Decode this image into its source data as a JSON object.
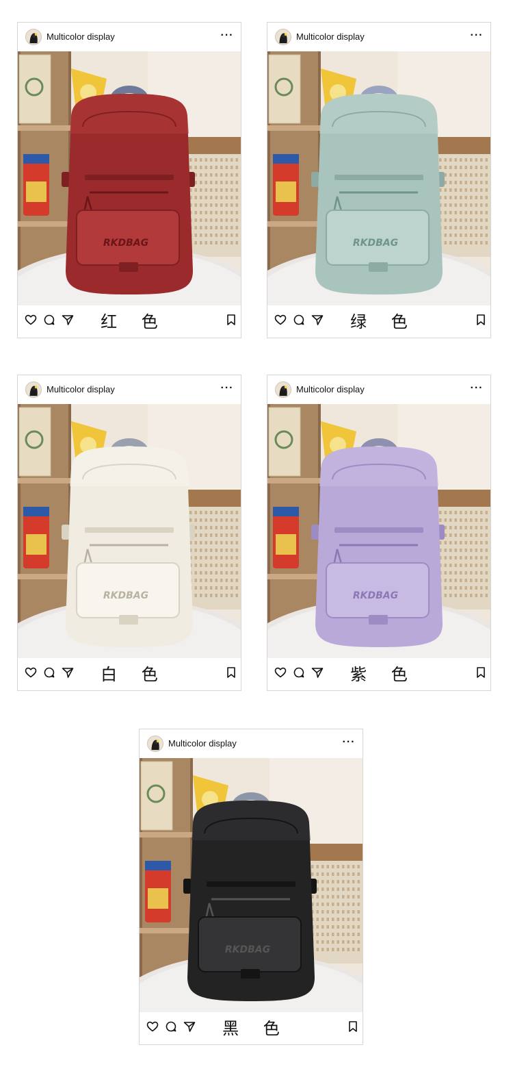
{
  "cards": [
    {
      "username": "Multicolor display",
      "more_icon": "more-dots-icon",
      "color_label": "红 色",
      "bag_color": "#9b2a2c",
      "bag_shade": "#7e1f22",
      "bag_light": "#b23a3a",
      "accent": "#6a1518",
      "strap": "#6d7a9a"
    },
    {
      "username": "Multicolor display",
      "more_icon": "more-dots-icon",
      "color_label": "绿 色",
      "bag_color": "#a9c3bd",
      "bag_shade": "#8eaaa4",
      "bag_light": "#bdd3ce",
      "accent": "#6e958c",
      "strap": "#9aa4c0"
    },
    {
      "username": "Multicolor display",
      "more_icon": "more-dots-icon",
      "color_label": "白 色",
      "bag_color": "#f0ece1",
      "bag_shade": "#d9d3c4",
      "bag_light": "#f8f5ee",
      "accent": "#b9b2a2",
      "strap": "#9aa0ad"
    },
    {
      "username": "Multicolor display",
      "more_icon": "more-dots-icon",
      "color_label": "紫 色",
      "bag_color": "#b9a9d8",
      "bag_shade": "#9d8cc4",
      "bag_light": "#c8bbe3",
      "accent": "#8a78b5",
      "strap": "#8f8fb0"
    },
    {
      "username": "Multicolor display",
      "more_icon": "more-dots-icon",
      "color_label": "黑 色",
      "bag_color": "#232324",
      "bag_shade": "#141415",
      "bag_light": "#343436",
      "accent": "#555",
      "strap": "#8d95a8"
    }
  ],
  "footer_icons": [
    "heart-icon",
    "comment-icon",
    "send-icon",
    "bookmark-icon"
  ]
}
